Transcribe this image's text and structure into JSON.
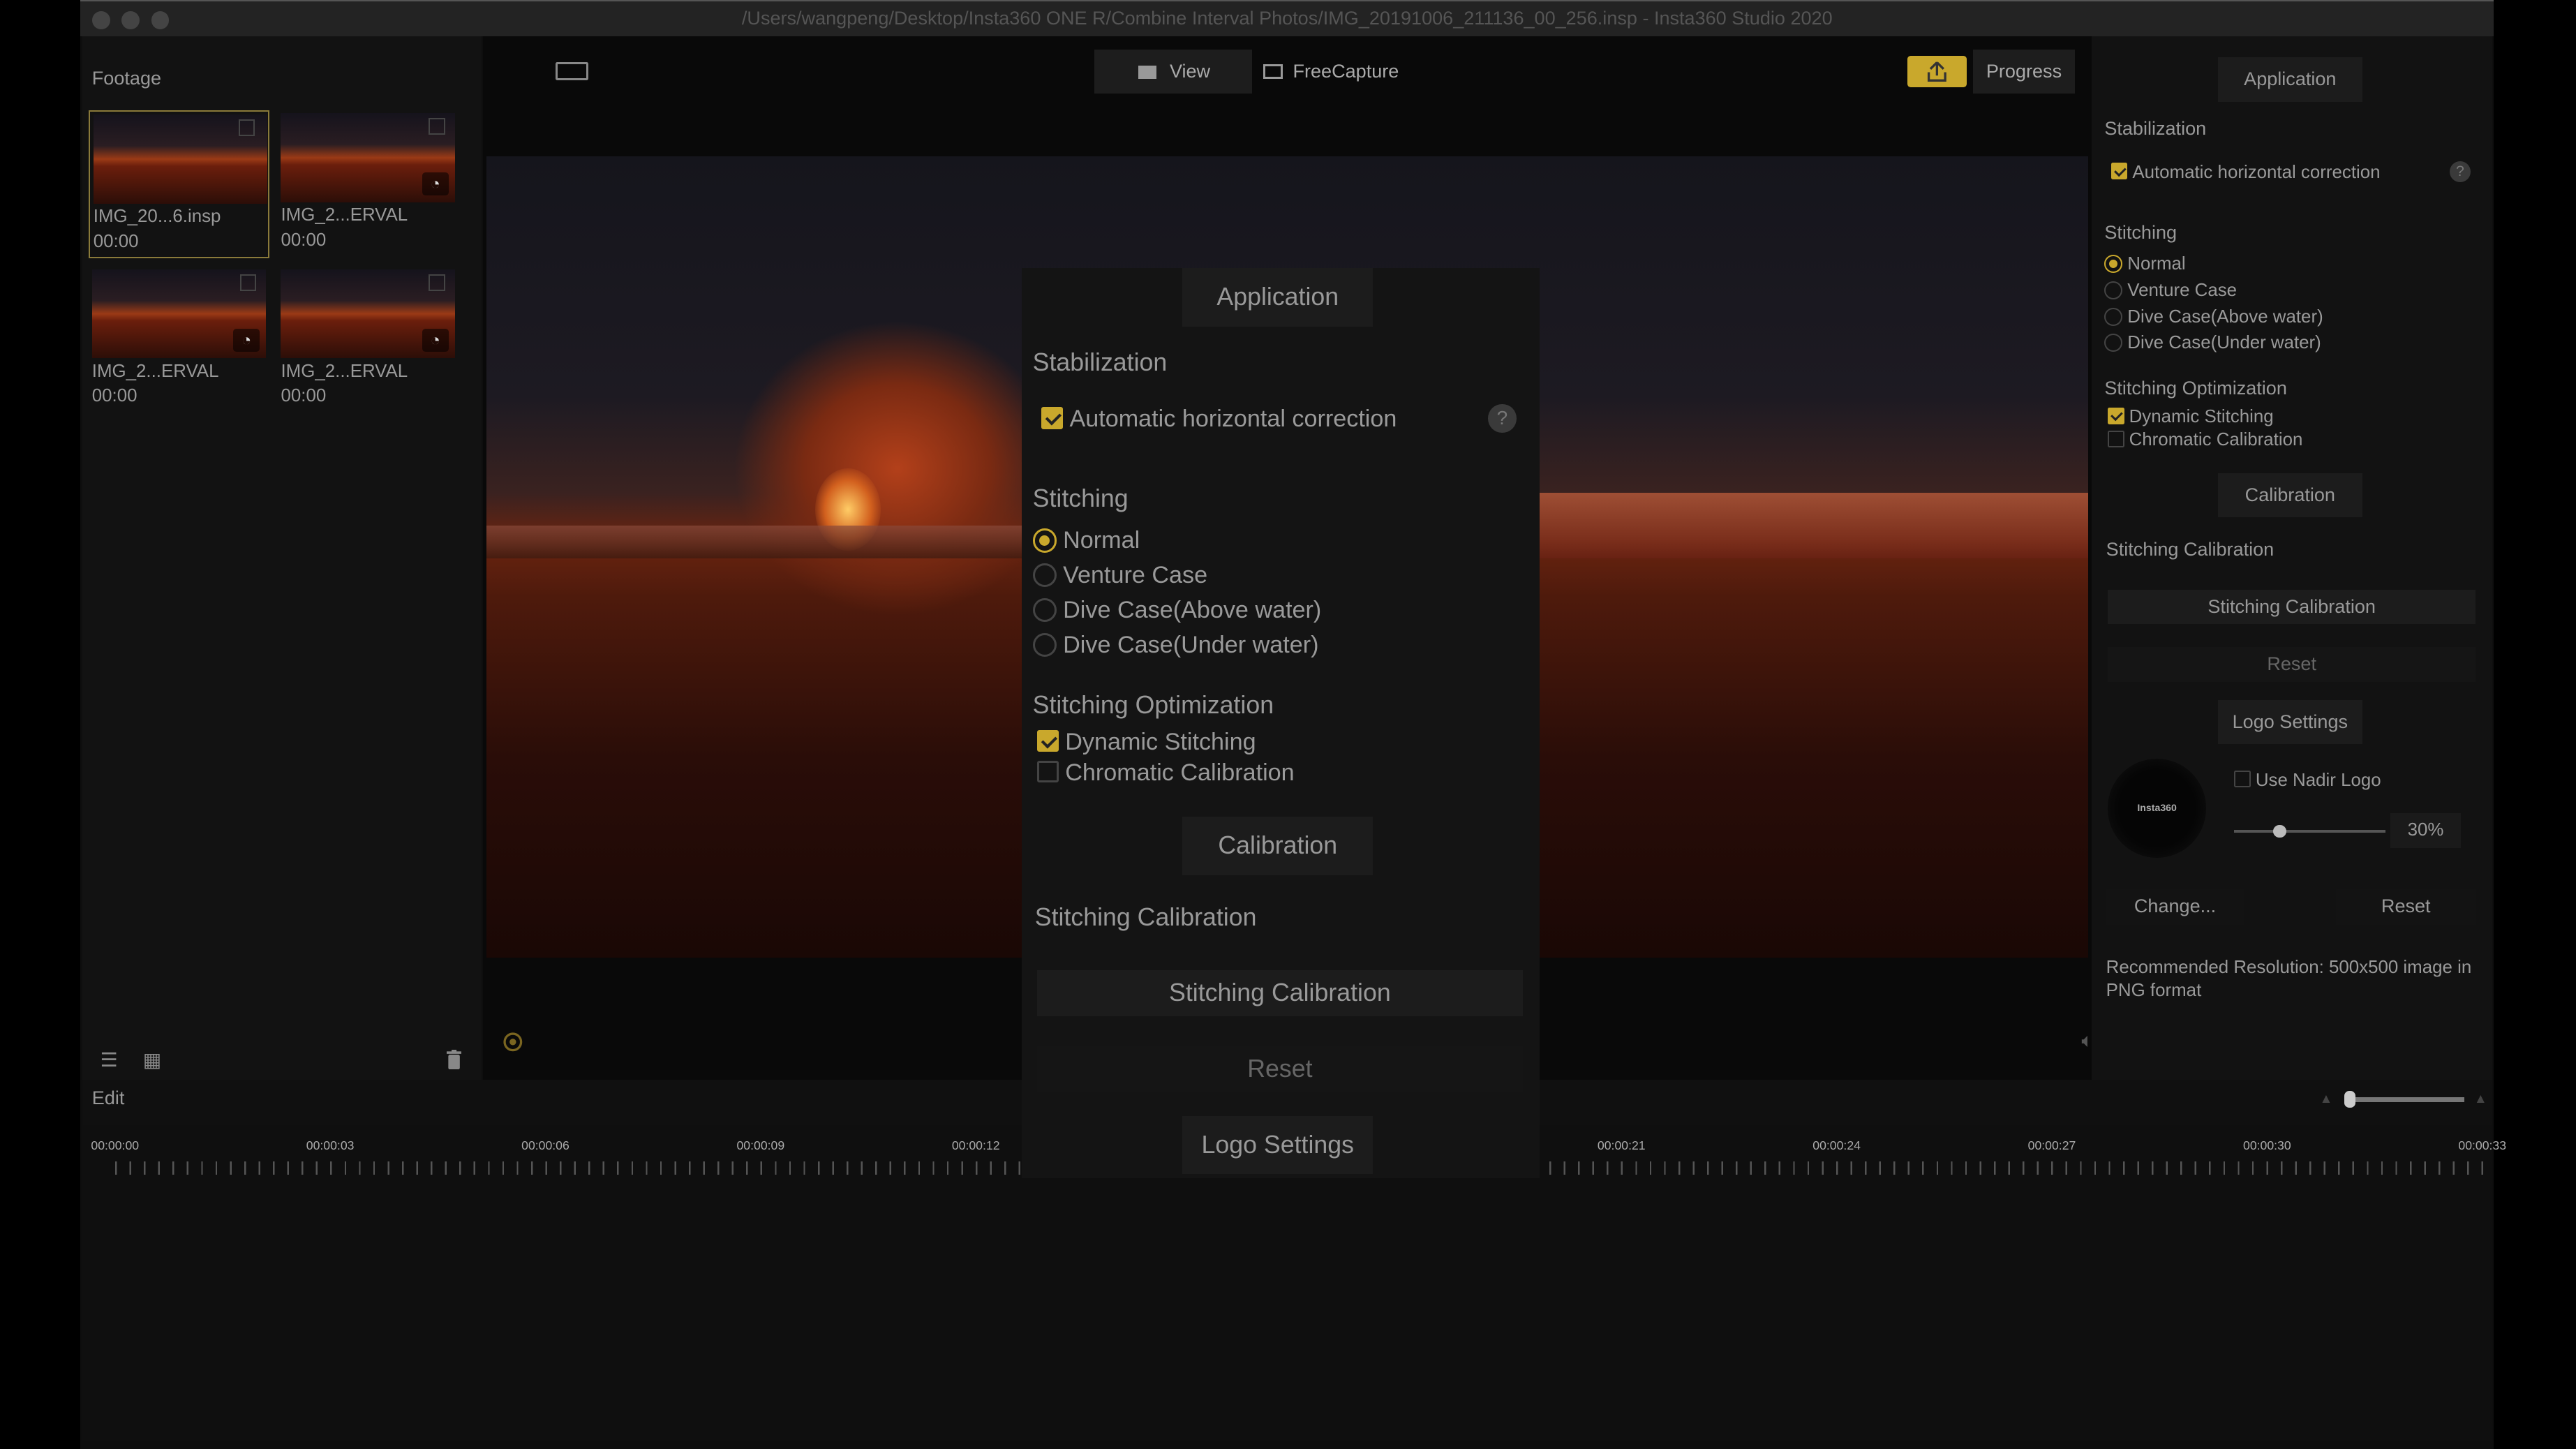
{
  "window": {
    "title": "/Users/wangpeng/Desktop/Insta360 ONE R/Combine Interval Photos/IMG_20191006_211136_00_256.insp - Insta360 Studio 2020"
  },
  "footage": {
    "title": "Footage",
    "items": [
      {
        "name": "IMG_20...6.insp",
        "duration": "00:00",
        "selected": true,
        "interval_badge": false
      },
      {
        "name": "IMG_2...ERVAL",
        "duration": "00:00",
        "selected": false,
        "interval_badge": true
      },
      {
        "name": "IMG_2...ERVAL",
        "duration": "00:00",
        "selected": false,
        "interval_badge": true
      },
      {
        "name": "IMG_2...ERVAL",
        "duration": "00:00",
        "selected": false,
        "interval_badge": true
      }
    ]
  },
  "toolbar": {
    "view": "View",
    "freecapture": "FreeCapture",
    "progress": "Progress",
    "accent": "#c9a82c"
  },
  "panel": {
    "application": "Application",
    "stabilization": "Stabilization",
    "auto_horizontal": "Automatic horizontal correction",
    "auto_horizontal_checked": true,
    "help": "?",
    "stitching": "Stitching",
    "stitching_options": [
      "Normal",
      "Venture Case",
      "Dive Case(Above water)",
      "Dive Case(Under water)"
    ],
    "stitching_selected": "Normal",
    "optimization": "Stitching Optimization",
    "dynamic_stitching": "Dynamic Stitching",
    "dynamic_checked": true,
    "chromatic": "Chromatic Calibration",
    "chromatic_checked": false,
    "calibration": "Calibration",
    "stitching_calibration_label": "Stitching Calibration",
    "stitching_calibration_button": "Stitching Calibration",
    "reset": "Reset",
    "logo_settings": "Logo Settings",
    "logo_text": "Insta360",
    "use_nadir": "Use Nadir Logo",
    "use_nadir_checked": false,
    "logo_size_percent": 30,
    "logo_size_label": "30%",
    "change": "Change...",
    "logo_reset": "Reset",
    "recommendation": "Recommended Resolution: 500x500 image in PNG format"
  },
  "edit": {
    "label": "Edit"
  },
  "timeline": {
    "ticks": [
      "00:00:00",
      "00:00:03",
      "00:00:06",
      "00:00:09",
      "00:00:12",
      "00:00:21",
      "00:00:24",
      "00:00:27",
      "00:00:30",
      "00:00:33"
    ]
  }
}
